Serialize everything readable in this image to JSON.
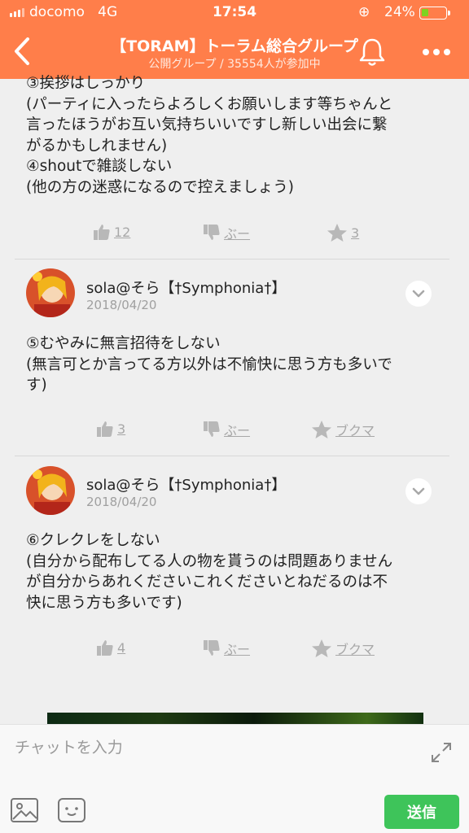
{
  "status_bar": {
    "carrier": "docomo",
    "network": "4G",
    "time": "17:54",
    "battery": "24%"
  },
  "header": {
    "title": "【TORAM】トーラム総合グループ",
    "subtitle": "公開グループ / 35554人が参加中",
    "accent_color": "#ff7e4a"
  },
  "posts": [
    {
      "text": "③挨拶はしっかり\n(パーティに入ったらよろしくお願いします等ちゃんと\n言ったほうがお互い気持ちいいですし新しい出会に繋\nがるかもしれません)\n④shoutで雑談しない\n(他の方の迷惑になるので控えましょう)",
      "likes": "12",
      "boo": "ぶー",
      "fav": "3"
    },
    {
      "user": "sola@そら【†Symphonia†】",
      "date": "2018/04/20",
      "text": "⑤むやみに無言招待をしない\n(無言可とか言ってる方以外は不愉快に思う方も多いで\nす)",
      "likes": "3",
      "boo": "ぶー",
      "fav": "ブクマ"
    },
    {
      "user": "sola@そら【†Symphonia†】",
      "date": "2018/04/20",
      "text": "⑥クレクレをしない\n(自分から配布してる人の物を貰うのは問題ありません\nが自分からあれくださいこれくださいとねだるのは不\n快に思う方も多いです)",
      "likes": "4",
      "boo": "ぶー",
      "fav": "ブクマ"
    }
  ],
  "composer": {
    "placeholder": "チャットを入力",
    "send_label": "送信",
    "send_color": "#3ec45a"
  },
  "icons": [
    "back-chevron-icon",
    "bell-icon",
    "more-icon",
    "thumbs-up-icon",
    "thumbs-down-icon",
    "star-icon",
    "chevron-down-icon",
    "expand-icon",
    "image-icon",
    "sticker-icon"
  ]
}
